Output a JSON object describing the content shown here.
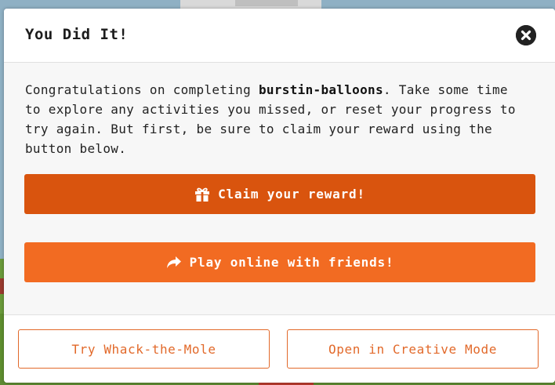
{
  "modal": {
    "title": "You Did It!",
    "message_prefix": "Congratulations on completing ",
    "activity_name": "burstin-balloons",
    "message_suffix": ". Take some time to explore any activities you missed, or reset your progress to try again. But first, be sure to claim your reward using the button below.",
    "claim_button_label": "Claim your reward!",
    "play_online_button_label": "Play online with friends!",
    "whack_button_label": "Try Whack-the-Mole",
    "creative_button_label": "Open in Creative Mode"
  },
  "icons": {
    "close": "close-circle-icon",
    "claim": "gift-icon",
    "play_online": "share-arrow-icon"
  },
  "colors": {
    "claim_button": "#d9540e",
    "play_button": "#f26b22",
    "outline_button": "#e2692a"
  }
}
